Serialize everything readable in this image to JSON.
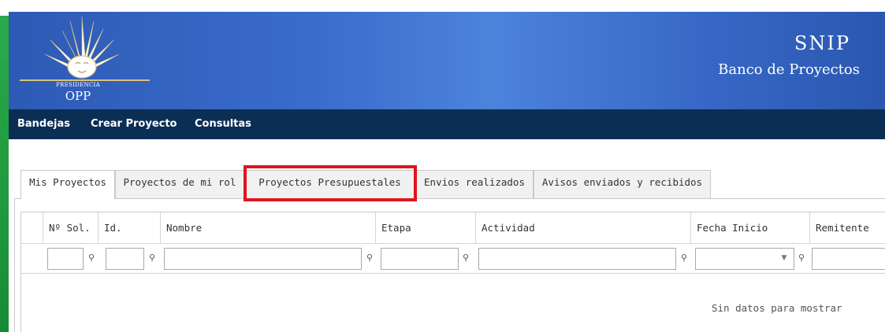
{
  "header": {
    "logo": {
      "line1": "PRESIDENCIA",
      "line2": "OPP"
    },
    "title": "SNIP",
    "subtitle": "Banco de Proyectos"
  },
  "nav": {
    "items": [
      {
        "label": "Bandejas"
      },
      {
        "label": "Crear Proyecto"
      },
      {
        "label": "Consultas"
      }
    ]
  },
  "tabs": [
    {
      "label": "Mis Proyectos",
      "active": true
    },
    {
      "label": "Proyectos de mi rol",
      "active": false
    },
    {
      "label": "Proyectos Presupuestales",
      "active": false,
      "highlighted": true
    },
    {
      "label": "Envios realizados",
      "active": false
    },
    {
      "label": "Avisos enviados y recibidos",
      "active": false
    }
  ],
  "grid": {
    "columns": [
      {
        "label": "Nº Sol."
      },
      {
        "label": "Id."
      },
      {
        "label": "Nombre"
      },
      {
        "label": "Etapa"
      },
      {
        "label": "Actividad"
      },
      {
        "label": "Fecha Inicio"
      },
      {
        "label": "Remitente"
      }
    ],
    "empty_message": "Sin datos para mostrar"
  },
  "colors": {
    "header_blue": "#3a6ccc",
    "nav_bg": "#0b2e55",
    "highlight_red": "#e0141e",
    "accent_green": "#2aa84a"
  },
  "icons": {
    "filter": "filter-pin-icon",
    "dropdown": "chevron-down-icon"
  }
}
